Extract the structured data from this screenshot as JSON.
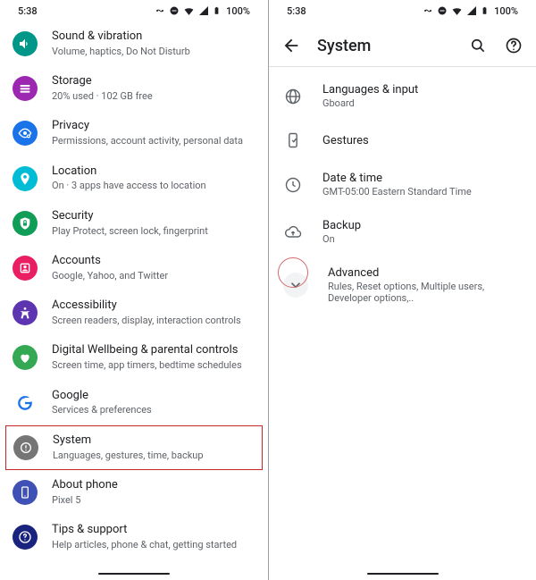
{
  "status": {
    "time": "5:38",
    "battery": "100%"
  },
  "left": {
    "items": [
      {
        "title": "Sound & vibration",
        "sub": "Volume, haptics, Do Not Disturb"
      },
      {
        "title": "Storage",
        "sub": "20% used · 102 GB free"
      },
      {
        "title": "Privacy",
        "sub": "Permissions, account activity, personal data"
      },
      {
        "title": "Location",
        "sub": "On · 3 apps have access to location"
      },
      {
        "title": "Security",
        "sub": "Play Protect, screen lock, fingerprint"
      },
      {
        "title": "Accounts",
        "sub": "Google, Yahoo, and Twitter"
      },
      {
        "title": "Accessibility",
        "sub": "Screen readers, display, interaction controls"
      },
      {
        "title": "Digital Wellbeing & parental controls",
        "sub": "Screen time, app timers, bedtime schedules"
      },
      {
        "title": "Google",
        "sub": "Services & preferences"
      },
      {
        "title": "System",
        "sub": "Languages, gestures, time, backup"
      },
      {
        "title": "About phone",
        "sub": "Pixel 5"
      },
      {
        "title": "Tips & support",
        "sub": "Help articles, phone & chat, getting started"
      }
    ]
  },
  "right": {
    "page_title": "System",
    "items": [
      {
        "title": "Languages & input",
        "sub": "Gboard"
      },
      {
        "title": "Gestures",
        "sub": ""
      },
      {
        "title": "Date & time",
        "sub": "GMT-05:00 Eastern Standard Time"
      },
      {
        "title": "Backup",
        "sub": "On"
      },
      {
        "title": "Advanced",
        "sub": "Rules, Reset options, Multiple users, Developer options,.."
      }
    ]
  }
}
